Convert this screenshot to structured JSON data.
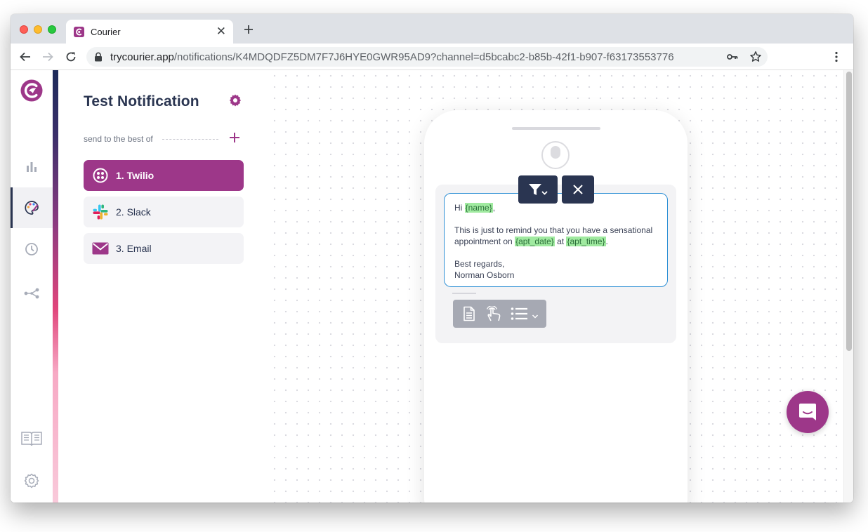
{
  "browser": {
    "tab_title": "Courier",
    "url_host": "trycourier.app",
    "url_path": "/notifications/K4MDQDFZ5DM7F7J6HYE0GWR95AD9?channel=d5bcabc2-b85b-42f1-b907-f63173553776"
  },
  "sidebar": {
    "icons": [
      "courier-logo-icon",
      "analytics-icon",
      "designer-icon",
      "history-icon",
      "integrations-icon",
      "docs-icon",
      "settings-icon"
    ]
  },
  "panel": {
    "title": "Test Notification",
    "send_to_label": "send to the best of",
    "channels": [
      {
        "label": "1.  Twilio",
        "icon": "twilio-icon"
      },
      {
        "label": "2.  Slack",
        "icon": "slack-icon"
      },
      {
        "label": "3.  Email",
        "icon": "email-icon"
      }
    ]
  },
  "editor": {
    "greeting_pre": "Hi ",
    "var_name": "{name}",
    "greeting_post": ",",
    "body_pre": "This is just to remind you that you have a sensational appointment on ",
    "var_date": "{apt_date}",
    "body_mid": " at ",
    "var_time": "{apt_time}",
    "body_post": ".",
    "signoff": "Best regards,",
    "signature": "Norman Osborn"
  },
  "colors": {
    "brand": "#9d3789",
    "navy": "#2a3551",
    "variable_bg": "#a0eaa0",
    "editor_border": "#2d8fd5"
  }
}
